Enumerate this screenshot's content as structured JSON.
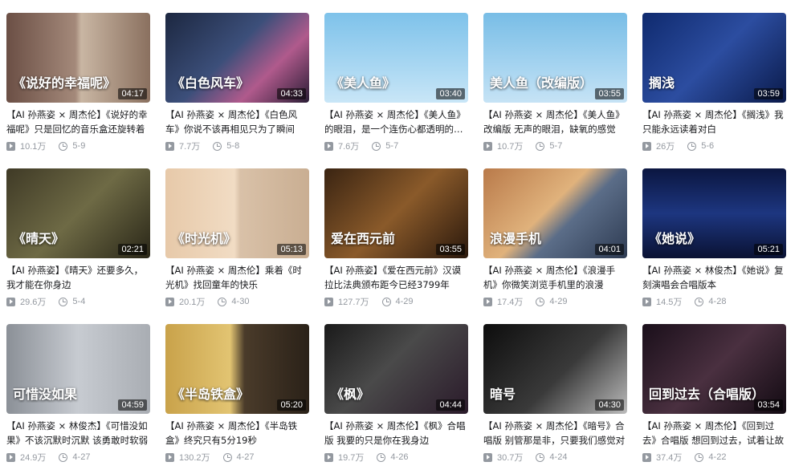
{
  "videos": [
    {
      "overlay": "《说好的幸福呢》",
      "duration": "04:17",
      "title": "【AI 孙燕姿 × 周杰伦】《说好的幸福呢》只是回忆的音乐盒还旋转着",
      "views": "10.1万",
      "date": "5-9",
      "thumb_bg": "linear-gradient(90deg,#6b4f45 0%,#a4897a 48%,#c9b6a3 52%,#8a705f 100%)"
    },
    {
      "overlay": "《白色风车》",
      "duration": "04:33",
      "title": "【AI 孙燕姿 × 周杰伦】《白色风车》你说不该再相见只为了瞬间",
      "views": "7.7万",
      "date": "5-8",
      "thumb_bg": "linear-gradient(135deg,#1c2740 0%,#3c4f7a 45%,#b05a8c 70%,#2a1d35 100%)"
    },
    {
      "overlay": "《美人鱼》",
      "duration": "03:40",
      "title": "【AI 孙燕姿 × 周杰伦】《美人鱼》的眼泪，是一个连伤心都透明的世界",
      "views": "7.6万",
      "date": "5-7",
      "thumb_bg": "linear-gradient(180deg,#7ec2ea 0%,#a9d7f2 60%,#c9e6f7 100%)"
    },
    {
      "overlay": "美人鱼（改编版）",
      "duration": "03:55",
      "title": "【AI 孙燕姿 × 周杰伦】《美人鱼》改编版 无声的眼泪，缺氧的感觉",
      "views": "10.7万",
      "date": "5-7",
      "thumb_bg": "linear-gradient(180deg,#78bde6 0%,#a6d4f0 60%,#c6e3f5 100%)"
    },
    {
      "overlay": "搁浅",
      "duration": "03:59",
      "title": "【AI 孙燕姿 × 周杰伦】《搁浅》我只能永远读着对白",
      "views": "26万",
      "date": "5-6",
      "thumb_bg": "linear-gradient(135deg,#0f2a6e 0%,#2c4da0 50%,#0a1a4a 100%)"
    },
    {
      "overlay": "《晴天》",
      "duration": "02:21",
      "title": "【AI 孙燕姿】《晴天》还要多久，我才能在你身边",
      "views": "29.6万",
      "date": "5-4",
      "thumb_bg": "linear-gradient(135deg,#3f3a26 0%,#6e6a45 50%,#2a2718 100%)"
    },
    {
      "overlay": "《时光机》",
      "duration": "05:13",
      "title": "【AI 孙燕姿 × 周杰伦】乘着《时光机》找回童年的快乐",
      "views": "20.1万",
      "date": "4-30",
      "thumb_bg": "linear-gradient(90deg,#e7c9a9 0%,#f1dcc4 48%,#d9c1a8 52%,#c9ae92 100%)"
    },
    {
      "overlay": "爱在西元前",
      "duration": "03:55",
      "title": "【AI 孙燕姿】《爱在西元前》汉谟拉比法典颁布距今已经3799年",
      "views": "127.7万",
      "date": "4-29",
      "thumb_bg": "linear-gradient(135deg,#3a2412 0%,#8a5a2a 50%,#2a180c 100%)"
    },
    {
      "overlay": "浪漫手机",
      "duration": "04:01",
      "title": "【AI 孙燕姿 × 周杰伦】《浪漫手机》你微笑浏览手机里的浪漫",
      "views": "17.4万",
      "date": "4-29",
      "thumb_bg": "linear-gradient(135deg,#b97a4a 0%,#e0b27c 45%,#5b6d88 60%,#2e3b52 100%)"
    },
    {
      "overlay": "《她说》",
      "duration": "05:21",
      "title": "【AI 孙燕姿 × 林俊杰】《她说》复刻演唱会合唱版本",
      "views": "14.5万",
      "date": "4-28",
      "thumb_bg": "linear-gradient(180deg,#0b1640 0%,#1d3680 50%,#0a1233 100%)"
    },
    {
      "overlay": "可惜没如果",
      "duration": "04:59",
      "title": "【AI 孙燕姿 × 林俊杰】《可惜没如果》不该沉默时沉默 该勇敢时软弱",
      "views": "24.9万",
      "date": "4-27",
      "thumb_bg": "linear-gradient(90deg,#8b9097 0%,#c7cbd1 50%,#a9adb3 100%)"
    },
    {
      "overlay": "《半岛铁盒》",
      "duration": "05:20",
      "title": "【AI 孙燕姿 × 周杰伦】《半岛铁盒》终究只有5分19秒",
      "views": "130.2万",
      "date": "4-27",
      "thumb_bg": "linear-gradient(90deg,#c9a24a 0%,#e2c472 45%,#4a3b2a 55%,#2a2118 100%)"
    },
    {
      "overlay": "《枫》",
      "duration": "04:44",
      "title": "【AI 孙燕姿 × 周杰伦】《枫》合唱版 我要的只是你在我身边",
      "views": "19.7万",
      "date": "4-26",
      "thumb_bg": "linear-gradient(135deg,#1a1a1a 0%,#4a4a4a 45%,#2a1a2a 100%)"
    },
    {
      "overlay": "暗号",
      "duration": "04:30",
      "title": "【AI 孙燕姿 × 周杰伦】《暗号》合唱版 别管那是非，只要我们感觉对",
      "views": "30.7万",
      "date": "4-24",
      "thumb_bg": "linear-gradient(135deg,#0d0d0d 0%,#3a3a3a 55%,#bcbcbc 100%)"
    },
    {
      "overlay": "回到过去（合唱版）",
      "duration": "03:54",
      "title": "【AI 孙燕姿 × 周杰伦】《回到过去》合唱版 想回到过去，试着让故",
      "views": "37.4万",
      "date": "4-22",
      "thumb_bg": "linear-gradient(135deg,#1a0f1a 0%,#4a3040 50%,#120a12 100%)"
    }
  ]
}
